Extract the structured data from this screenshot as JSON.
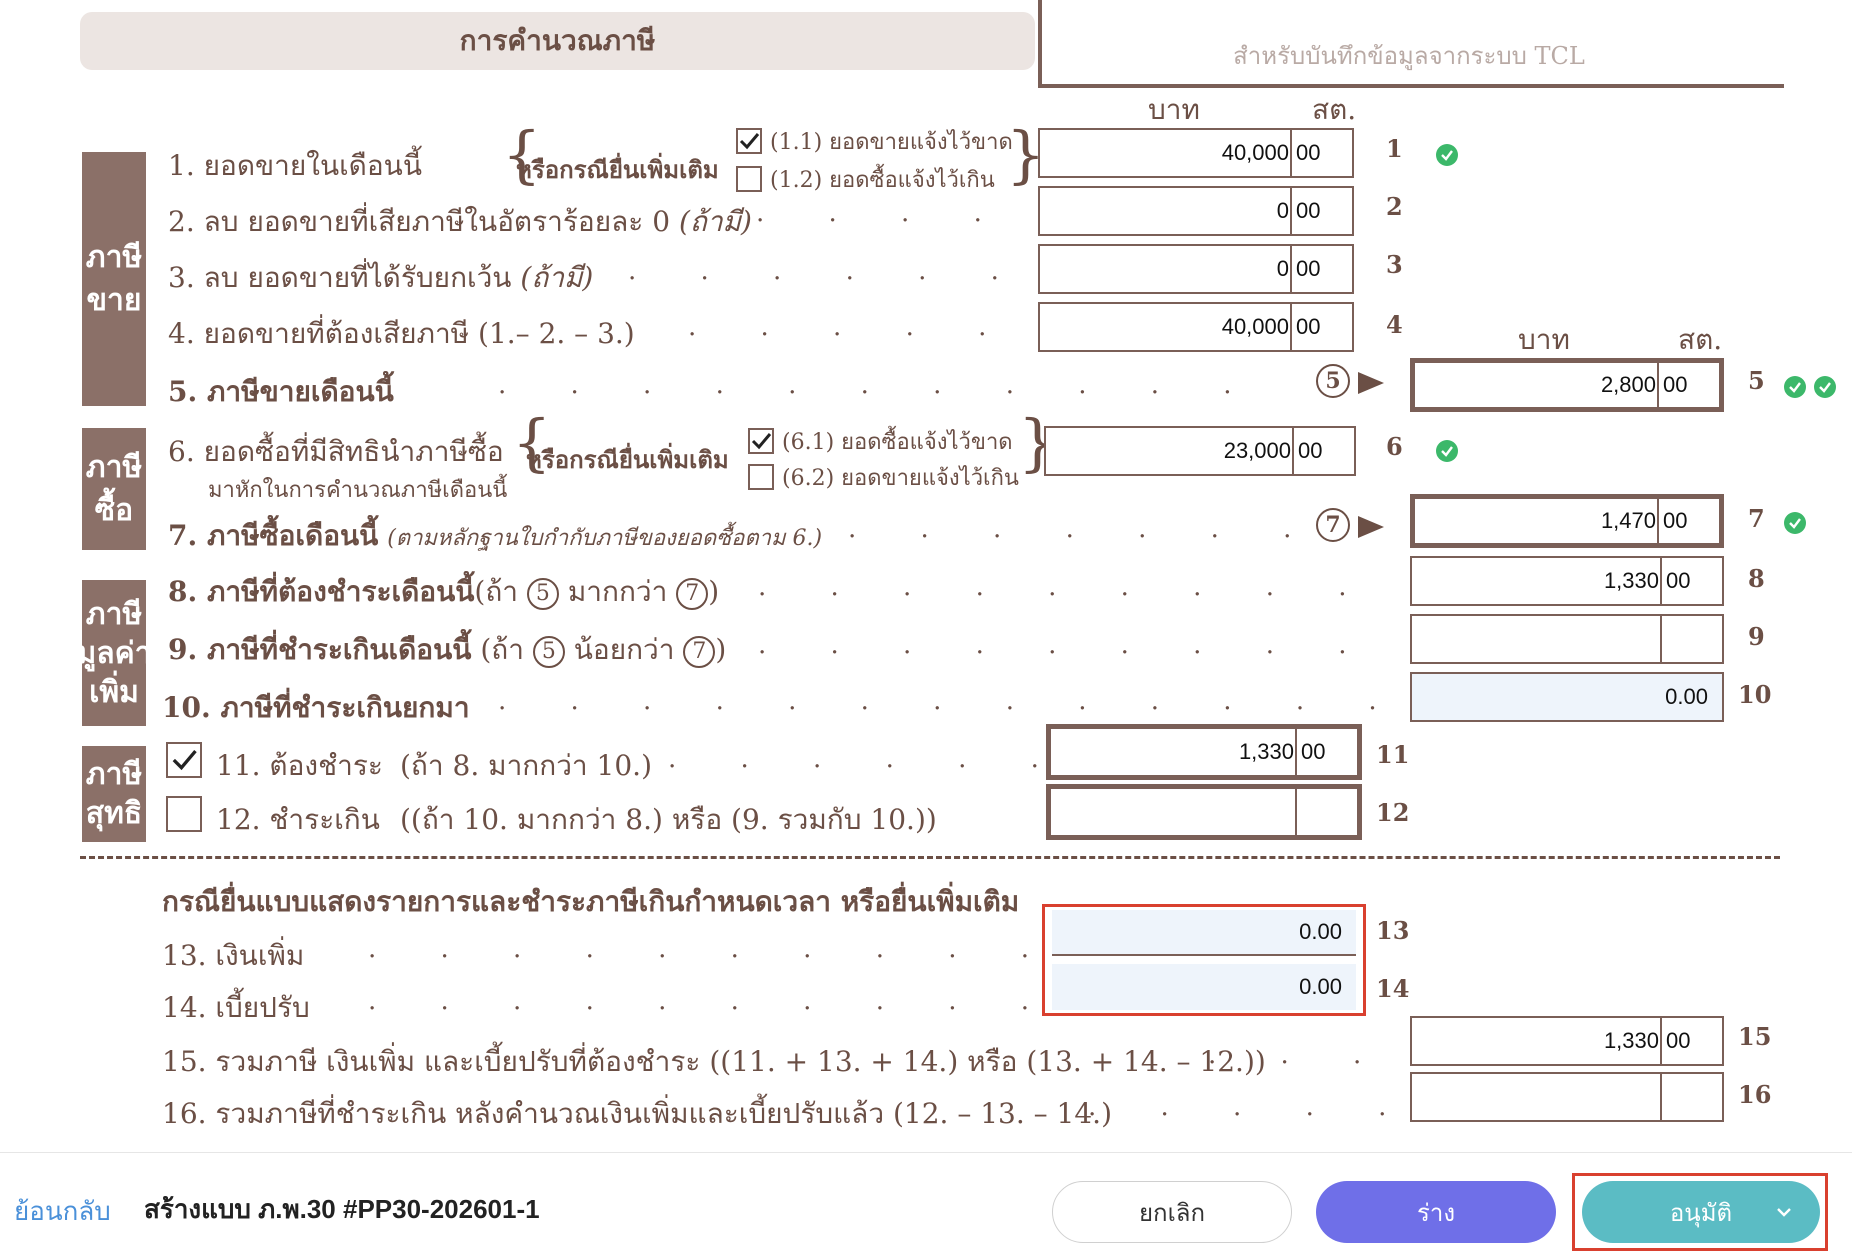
{
  "header": {
    "title": "การคำนวณภาษี",
    "tcl_label": "สำหรับบันทึกข้อมูลจากระบบ TCL"
  },
  "units": {
    "baht": "บาท",
    "satang": "สต."
  },
  "sections": {
    "sales": [
      "ภาษี",
      "ขาย"
    ],
    "purchase": [
      "ภาษี",
      "ซื้อ"
    ],
    "vat": [
      "ภาษี",
      "มูลค่า",
      "เพิ่ม"
    ],
    "net": [
      "ภาษี",
      "สุทธิ"
    ]
  },
  "supplement": {
    "label": "หรือกรณียื่นเพิ่มเติม",
    "opt_1_1": "(1.1) ยอดขายแจ้งไว้ขาด",
    "opt_1_2": "(1.2) ยอดซื้อแจ้งไว้เกิน",
    "opt_6_1": "(6.1) ยอดซื้อแจ้งไว้ขาด",
    "opt_6_2": "(6.2) ยอดขายแจ้งไว้เกิน"
  },
  "rows": {
    "r1": {
      "label": "1. ยอดขายในเดือนนี้",
      "baht": "40,000",
      "satang": "00",
      "no": "1"
    },
    "r2": {
      "label": "2. ลบ ยอดขายที่เสียภาษีในอัตราร้อยละ 0",
      "suffix": "(ถ้ามี)",
      "baht": "0",
      "satang": "00",
      "no": "2"
    },
    "r3": {
      "label": "3. ลบ ยอดขายที่ได้รับยกเว้น",
      "suffix": "(ถ้ามี)",
      "baht": "0",
      "satang": "00",
      "no": "3"
    },
    "r4": {
      "label": "4. ยอดขายที่ต้องเสียภาษี (1.– 2. – 3.)",
      "baht": "40,000",
      "satang": "00",
      "no": "4"
    },
    "r5": {
      "label": "5. ภาษีขายเดือนนี้",
      "circle": "5",
      "baht": "2,800",
      "satang": "00",
      "no": "5"
    },
    "r6": {
      "label": "6. ยอดซื้อที่มีสิทธินำภาษีซื้อ",
      "sub": "มาหักในการคำนวณภาษีเดือนนี้",
      "baht": "23,000",
      "satang": "00",
      "no": "6"
    },
    "r7": {
      "label": "7. ภาษีซื้อเดือนนี้",
      "suffix": "(ตามหลักฐานใบกำกับภาษีของยอดซื้อตาม 6.)",
      "circle": "7",
      "baht": "1,470",
      "satang": "00",
      "no": "7"
    },
    "r8": {
      "label": "8. ภาษีที่ต้องชำระเดือนนี้",
      "cond_a": "(ถ้า",
      "c1": "5",
      "cond_b": "มากกว่า",
      "c2": "7",
      "cond_c": ")",
      "baht": "1,330",
      "satang": "00",
      "no": "8"
    },
    "r9": {
      "label": "9. ภาษีที่ชำระเกินเดือนนี้",
      "cond_a": "(ถ้า",
      "c1": "5",
      "cond_b": "น้อยกว่า",
      "c2": "7",
      "cond_c": ")",
      "baht": "",
      "satang": "",
      "no": "9"
    },
    "r10": {
      "label": "10. ภาษีที่ชำระเกินยกมา",
      "value": "0.00",
      "no": "10"
    },
    "r11": {
      "label": "11. ต้องชำระ",
      "cond": "(ถ้า 8. มากกว่า 10.)",
      "baht": "1,330",
      "satang": "00",
      "no": "11"
    },
    "r12": {
      "label": "12. ชำระเกิน",
      "cond": "((ถ้า 10. มากกว่า 8.) หรือ (9. รวมกับ 10.))",
      "baht": "",
      "satang": "",
      "no": "12"
    },
    "late_heading": "กรณียื่นแบบแสดงรายการและชำระภาษีเกินกำหนดเวลา หรือยื่นเพิ่มเติม",
    "r13": {
      "label": "13. เงินเพิ่ม",
      "value": "0.00",
      "no": "13"
    },
    "r14": {
      "label": "14. เบี้ยปรับ",
      "value": "0.00",
      "no": "14"
    },
    "r15": {
      "label": "15. รวมภาษี เงินเพิ่ม และเบี้ยปรับที่ต้องชำระ ((11. + 13. + 14.) หรือ (13. + 14. – 12.))",
      "baht": "1,330",
      "satang": "00",
      "no": "15"
    },
    "r16": {
      "label": "16. รวมภาษีที่ชำระเกิน หลังคำนวณเงินเพิ่มและเบี้ยปรับแล้ว (12. – 13. – 14.)",
      "baht": "",
      "satang": "",
      "no": "16"
    }
  },
  "footer": {
    "back": "ย้อนกลับ",
    "title": "สร้างแบบ ภ.พ.30 #PP30-202601-1",
    "cancel": "ยกเลิก",
    "draft": "ร่าง",
    "approve": "อนุมัติ"
  },
  "colors": {
    "approve": "#5bbcc4",
    "draft": "#6f6fe8",
    "highlight": "#d9402f",
    "ok": "#3cb86a"
  }
}
